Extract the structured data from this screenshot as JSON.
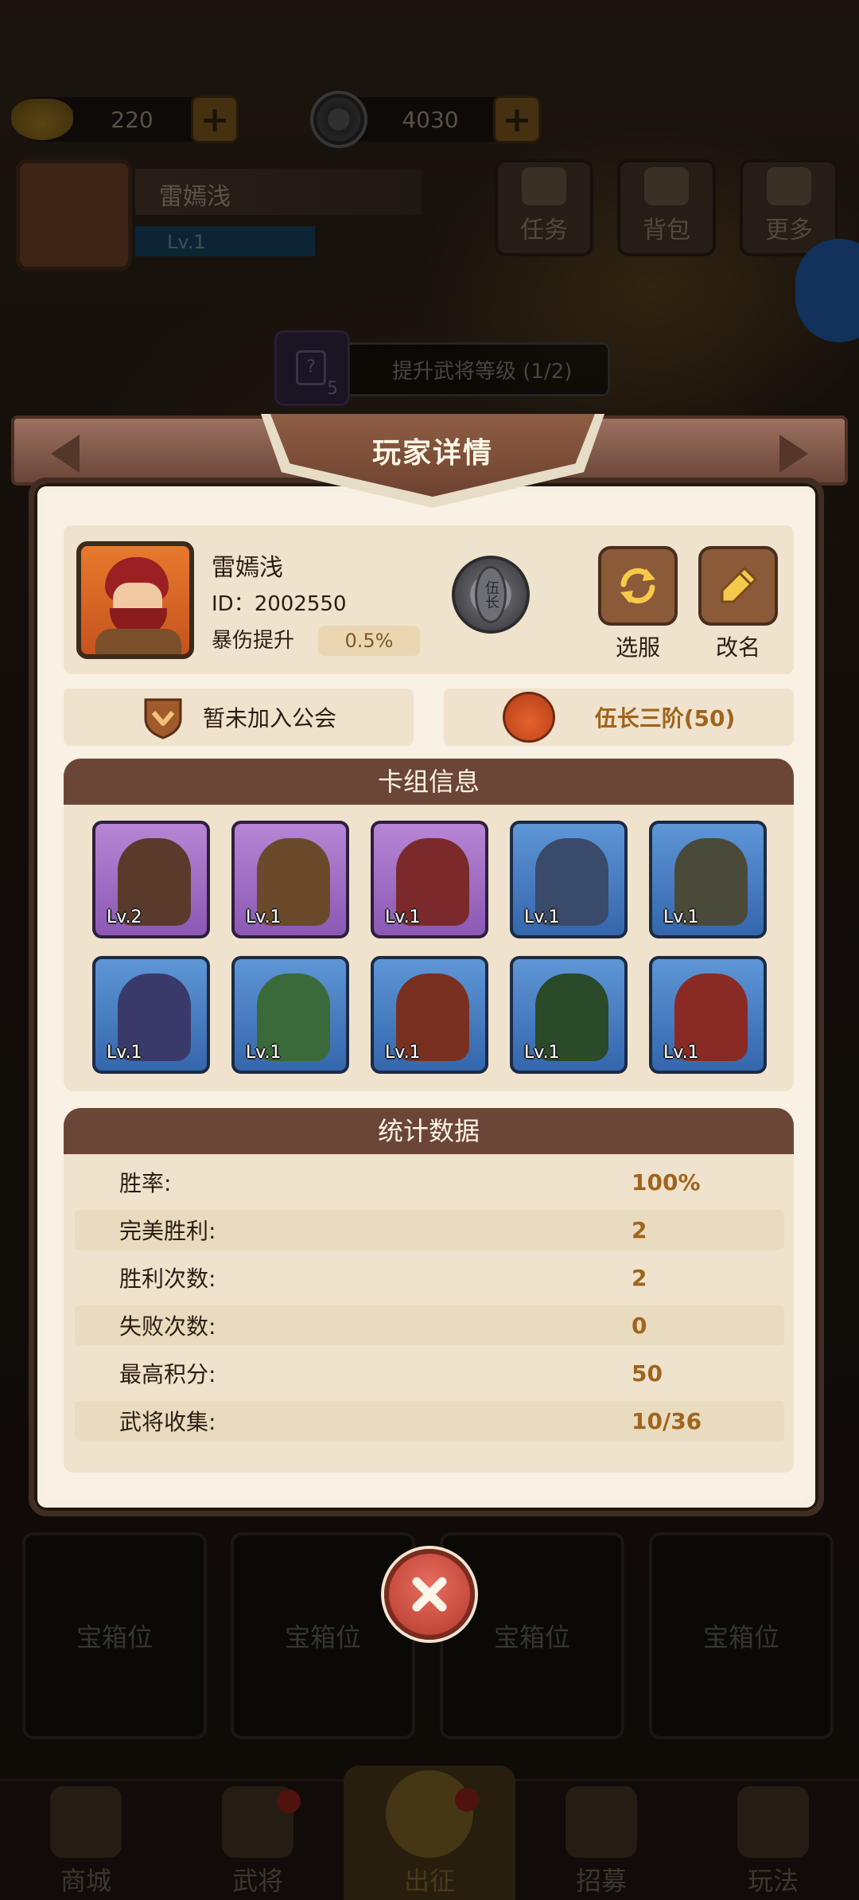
{
  "top": {
    "gold_amount": "220",
    "coin_amount": "4030",
    "player_name": "雷嫣浅",
    "level": "Lv.1",
    "buttons": [
      {
        "label": "任务",
        "icon": "scroll-icon"
      },
      {
        "label": "背包",
        "icon": "bag-icon"
      },
      {
        "label": "更多",
        "icon": "menu-icon"
      }
    ],
    "hint_count": "5",
    "hint_text": "提升武将等级 (1/2)",
    "hint_card_symbol": "?"
  },
  "modal": {
    "title": "玩家详情",
    "player": {
      "name": "雷嫣浅",
      "id": "ID：2002550",
      "crit_label": "暴伤提升",
      "crit_value": "0.5%",
      "rank_badge_text": "伍长"
    },
    "buttons": {
      "server": "选服",
      "rename": "改名"
    },
    "guild_text": "暂未加入公会",
    "rank_text": "伍长三阶(50)",
    "deck_title": "卡组信息",
    "deck": [
      {
        "level": "Lv.2",
        "rarity": "purple"
      },
      {
        "level": "Lv.1",
        "rarity": "purple"
      },
      {
        "level": "Lv.1",
        "rarity": "purple"
      },
      {
        "level": "Lv.1",
        "rarity": "blue"
      },
      {
        "level": "Lv.1",
        "rarity": "blue"
      },
      {
        "level": "Lv.1",
        "rarity": "blue"
      },
      {
        "level": "Lv.1",
        "rarity": "blue"
      },
      {
        "level": "Lv.1",
        "rarity": "blue"
      },
      {
        "level": "Lv.1",
        "rarity": "blue"
      },
      {
        "level": "Lv.1",
        "rarity": "blue"
      }
    ],
    "stats_title": "统计数据",
    "stats": [
      {
        "label": "胜率:",
        "value": "100%"
      },
      {
        "label": "完美胜利:",
        "value": "2"
      },
      {
        "label": "胜利次数:",
        "value": "2"
      },
      {
        "label": "失败次数:",
        "value": "0"
      },
      {
        "label": "最高积分:",
        "value": "50"
      },
      {
        "label": "武将收集:",
        "value": "10/36"
      }
    ]
  },
  "chests": [
    "宝箱位",
    "宝箱位",
    "宝箱位",
    "宝箱位"
  ],
  "nav": [
    {
      "label": "商城"
    },
    {
      "label": "武将"
    },
    {
      "label": "出征"
    },
    {
      "label": "招募"
    },
    {
      "label": "玩法"
    }
  ],
  "colors": {
    "panel_bg": "#f6efe2",
    "section_header": "#6b4636",
    "accent_gold": "#a0641c",
    "card_purple": "#b686d4",
    "card_blue": "#5e96d6",
    "close_red": "#d2523f"
  }
}
